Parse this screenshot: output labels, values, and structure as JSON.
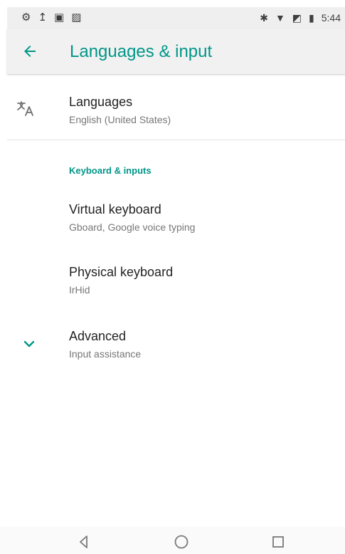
{
  "status_bar": {
    "time": "5:44",
    "left_icons": [
      "settings-icon",
      "upload-icon",
      "notification-icon",
      "image-icon"
    ],
    "right_icons": [
      "bluetooth-icon",
      "wifi-icon",
      "no-sim-icon",
      "battery-icon"
    ]
  },
  "app_bar": {
    "title": "Languages & input",
    "back_icon": "arrow-left-icon"
  },
  "languages": {
    "title": "Languages",
    "subtitle": "English (United States)",
    "icon": "translate-icon"
  },
  "keyboard_section": {
    "heading": "Keyboard & inputs",
    "items": [
      {
        "title": "Virtual keyboard",
        "subtitle": "Gboard, Google voice typing"
      },
      {
        "title": "Physical keyboard",
        "subtitle": "IrHid"
      },
      {
        "title": "Advanced",
        "subtitle": "Input assistance",
        "icon": "chevron-down-icon"
      }
    ]
  },
  "nav_bar": {
    "buttons": [
      "back-triangle-icon",
      "home-circle-icon",
      "recents-square-icon"
    ]
  },
  "colors": {
    "accent": "#009688",
    "text_primary": "#222222",
    "text_secondary": "#777777",
    "status_background": "#efefef",
    "app_bar_background": "#f1f1f1"
  }
}
